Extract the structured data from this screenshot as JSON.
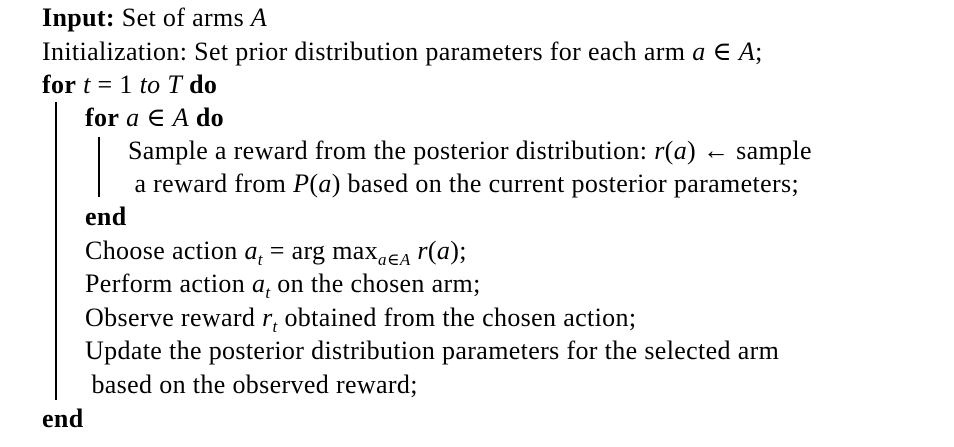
{
  "algorithm": {
    "lines": [
      {
        "indent": 0,
        "segments": [
          {
            "t": "Input:",
            "s": "b"
          },
          {
            "t": " Set of arms ",
            "s": ""
          },
          {
            "t": "A",
            "s": "i"
          }
        ]
      },
      {
        "indent": 0,
        "segments": [
          {
            "t": "Initialization: Set prior distribution parameters for each arm ",
            "s": ""
          },
          {
            "t": "a",
            "s": "i"
          },
          {
            "t": " ∈ ",
            "s": ""
          },
          {
            "t": "A",
            "s": "i"
          },
          {
            "t": ";",
            "s": ""
          }
        ]
      },
      {
        "indent": 0,
        "segments": [
          {
            "t": "for",
            "s": "b"
          },
          {
            "t": " ",
            "s": ""
          },
          {
            "t": "t",
            "s": "i"
          },
          {
            "t": " = 1 ",
            "s": ""
          },
          {
            "t": "to",
            "s": "i"
          },
          {
            "t": " ",
            "s": ""
          },
          {
            "t": "T",
            "s": "i"
          },
          {
            "t": " ",
            "s": ""
          },
          {
            "t": "do",
            "s": "b"
          }
        ]
      },
      {
        "indent": 1,
        "segments": [
          {
            "t": "for",
            "s": "b"
          },
          {
            "t": " ",
            "s": ""
          },
          {
            "t": "a",
            "s": "i"
          },
          {
            "t": " ∈ ",
            "s": ""
          },
          {
            "t": "A",
            "s": "i"
          },
          {
            "t": " ",
            "s": ""
          },
          {
            "t": "do",
            "s": "b"
          }
        ]
      },
      {
        "indent": 2,
        "segments": [
          {
            "t": "Sample a reward from the posterior distribution: ",
            "s": ""
          },
          {
            "t": "r",
            "s": "i"
          },
          {
            "t": "(",
            "s": ""
          },
          {
            "t": "a",
            "s": "i"
          },
          {
            "t": ") ← sample",
            "s": ""
          }
        ]
      },
      {
        "indent": 2.15,
        "segments": [
          {
            "t": "a reward from ",
            "s": ""
          },
          {
            "t": "P",
            "s": "i"
          },
          {
            "t": "(",
            "s": ""
          },
          {
            "t": "a",
            "s": "i"
          },
          {
            "t": ") based on the current posterior parameters;",
            "s": ""
          }
        ]
      },
      {
        "indent": 1,
        "segments": [
          {
            "t": "end",
            "s": "b"
          }
        ]
      },
      {
        "indent": 1,
        "segments": [
          {
            "t": "Choose action ",
            "s": ""
          },
          {
            "t": "a",
            "s": "i"
          },
          {
            "t": "t",
            "s": "sub"
          },
          {
            "t": " = arg max",
            "s": ""
          },
          {
            "t": "a∈A",
            "s": "sub"
          },
          {
            "t": " ",
            "s": ""
          },
          {
            "t": "r",
            "s": "i"
          },
          {
            "t": "(",
            "s": ""
          },
          {
            "t": "a",
            "s": "i"
          },
          {
            "t": ");",
            "s": ""
          }
        ]
      },
      {
        "indent": 1,
        "segments": [
          {
            "t": "Perform action ",
            "s": ""
          },
          {
            "t": "a",
            "s": "i"
          },
          {
            "t": "t",
            "s": "sub"
          },
          {
            "t": " on the chosen arm;",
            "s": ""
          }
        ]
      },
      {
        "indent": 1,
        "segments": [
          {
            "t": "Observe reward ",
            "s": ""
          },
          {
            "t": "r",
            "s": "i"
          },
          {
            "t": "t",
            "s": "sub"
          },
          {
            "t": " obtained from the chosen action;",
            "s": ""
          }
        ]
      },
      {
        "indent": 1,
        "segments": [
          {
            "t": "Update the posterior distribution parameters for the selected arm",
            "s": ""
          }
        ]
      },
      {
        "indent": 1.15,
        "segments": [
          {
            "t": "based on the observed reward;",
            "s": ""
          }
        ]
      },
      {
        "indent": 0,
        "segments": [
          {
            "t": "end",
            "s": "b"
          }
        ]
      }
    ]
  }
}
